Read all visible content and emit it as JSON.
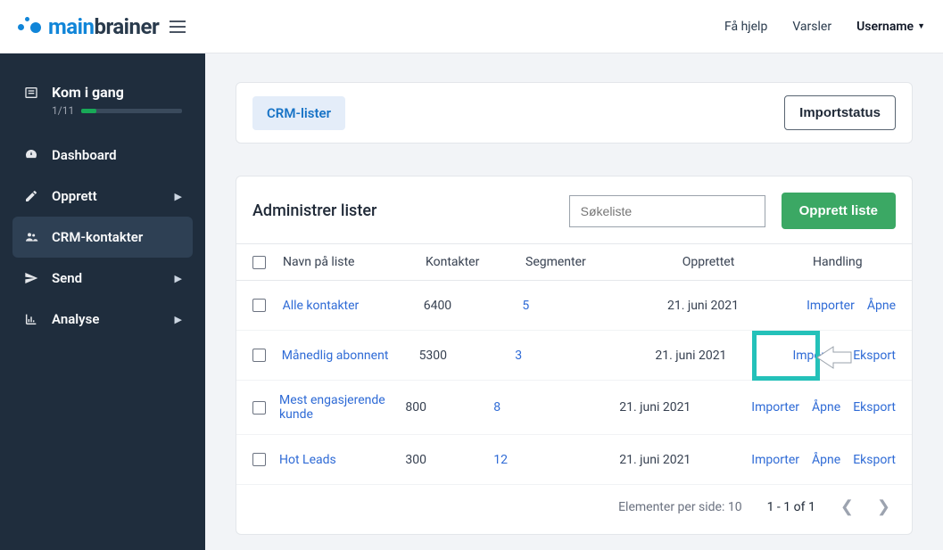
{
  "topbar": {
    "brand_left": "main",
    "brand_right": "brainer",
    "help": "Få hjelp",
    "alerts": "Varsler",
    "username": "Username"
  },
  "sidebar": {
    "start": {
      "label": "Kom i gang",
      "progress": "1/11"
    },
    "items": [
      {
        "label": "Dashboard",
        "has_sub": false
      },
      {
        "label": "Opprett",
        "has_sub": true
      },
      {
        "label": "CRM-kontakter",
        "has_sub": false,
        "active": true
      },
      {
        "label": "Send",
        "has_sub": true
      },
      {
        "label": "Analyse",
        "has_sub": true
      }
    ]
  },
  "header_card": {
    "pill": "CRM-lister",
    "import_status_btn": "Importstatus"
  },
  "panel": {
    "title": "Administrer lister",
    "search_placeholder": "Søkeliste",
    "create_btn": "Opprett liste"
  },
  "table": {
    "columns": {
      "name": "Navn på liste",
      "contacts": "Kontakter",
      "segments": "Segmenter",
      "created": "Opprettet",
      "actions": "Handling"
    },
    "rows": [
      {
        "name": "Alle kontakter",
        "contacts": "6400",
        "segments": "5",
        "created": "21. juni 2021",
        "actions": [
          "Importer",
          "Åpne"
        ]
      },
      {
        "name": "Månedlig abonnent",
        "contacts": "5300",
        "segments": "3",
        "created": "21. juni 2021",
        "actions": [
          "Importer",
          "Eksport"
        ]
      },
      {
        "name": "Mest engasjerende kunde",
        "contacts": "800",
        "segments": "8",
        "created": "21. juni 2021",
        "actions": [
          "Importer",
          "Åpne",
          "Eksport"
        ]
      },
      {
        "name": "Hot Leads",
        "contacts": "300",
        "segments": "12",
        "created": "21. juni 2021",
        "actions": [
          "Importer",
          "Åpne",
          "Eksport"
        ]
      }
    ]
  },
  "pager": {
    "per_page": "Elementer per side: 10",
    "range": "1 - 1 of 1"
  }
}
